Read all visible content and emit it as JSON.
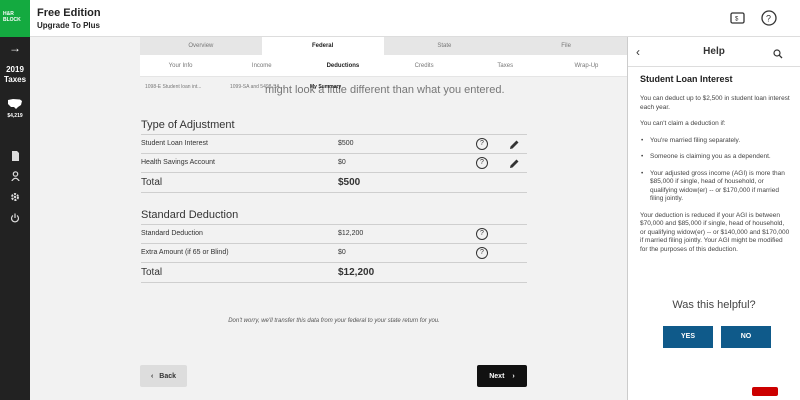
{
  "brand": {
    "logo_text": "H&R BLOCK",
    "title": "Free Edition",
    "subtitle": "Upgrade To Plus",
    "colors": {
      "brand_green": "#14aa40",
      "rail": "#222222",
      "help_button": "#0f5a8a"
    }
  },
  "topbar": {
    "icons": [
      "coupon-icon",
      "help-circle-icon"
    ]
  },
  "sidebar": {
    "year_line1": "2019",
    "year_line2": "Taxes",
    "refund_amount": "$4,219",
    "icons": [
      "arrow-right-icon",
      "us-map-icon",
      "document-icon",
      "person-icon",
      "gear-icon",
      "power-icon"
    ]
  },
  "nav": {
    "main_tabs": [
      {
        "label": "Overview"
      },
      {
        "label": "Federal"
      },
      {
        "label": "State"
      },
      {
        "label": "File"
      }
    ],
    "sub_tabs": [
      {
        "label": "Your Info"
      },
      {
        "label": "Income"
      },
      {
        "label": "Deductions"
      },
      {
        "label": "Credits"
      },
      {
        "label": "Taxes"
      },
      {
        "label": "Wrap-Up"
      }
    ],
    "doc_tabs": [
      {
        "label": "1098-E Student loan int..."
      },
      {
        "label": "1099-SA and 5498-SA..."
      },
      {
        "label": "My Summary"
      }
    ]
  },
  "main": {
    "faded_text": "might look a little different than what you entered.",
    "adjustment": {
      "title": "Type of Adjustment",
      "rows": [
        {
          "label": "Student Loan Interest",
          "value": "$500"
        },
        {
          "label": "Health Savings Account",
          "value": "$0"
        }
      ],
      "total_label": "Total",
      "total_value": "$500"
    },
    "standard": {
      "title": "Standard Deduction",
      "rows": [
        {
          "label": "Standard Deduction",
          "value": "$12,200"
        },
        {
          "label": "Extra Amount (if 65 or Blind)",
          "value": "$0"
        }
      ],
      "total_label": "Total",
      "total_value": "$12,200"
    },
    "note": "Don't worry, we'll transfer this data from your federal to your state return for you.",
    "back_label": "Back",
    "next_label": "Next"
  },
  "help": {
    "header": "Help",
    "title": "Student Loan Interest",
    "p1": "You can deduct up to $2,500 in student loan interest each year.",
    "p2": "You can't claim a deduction if:",
    "bullets": [
      "You're married filing separately.",
      "Someone is claiming you as a dependent.",
      "Your adjusted gross income (AGI) is more than $85,000 if single, head of household, or qualifying widow(er) -- or $170,000 if married filing jointly."
    ],
    "p3": "Your deduction is reduced if your AGI is between $70,000 and $85,000 if single, head of household, or qualifying widow(er) -- or $140,000 and $170,000 if married filing jointly. Your AGI might be modified for the purposes of this deduction.",
    "helpful_question": "Was this helpful?",
    "yes_label": "YES",
    "no_label": "NO"
  }
}
